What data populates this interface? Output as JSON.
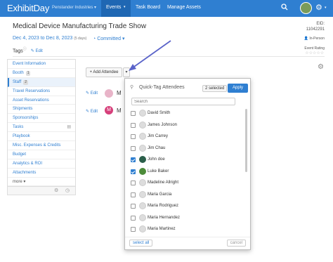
{
  "brand": {
    "logo": "ExhibitDay",
    "org": "Penstander Industries ▾"
  },
  "nav": {
    "events": "Events",
    "task_board": "Task Board",
    "manage_assets": "Manage Assets"
  },
  "event": {
    "title": "Medical Device Manufacturing Trade Show",
    "start": "Dec 4, 2023",
    "to": "to",
    "end": "Dec 8, 2023",
    "days": "(5 days)",
    "status": "Committed ▾",
    "eid_label": "EID:",
    "eid": "11042291",
    "type": "In-Person",
    "rating_label": "Event Rating",
    "tags_label": "Tags",
    "tags_edit": "Edit"
  },
  "sidebar": {
    "items": [
      {
        "label": "Event Information"
      },
      {
        "label": "Booth",
        "badge": "1"
      },
      {
        "label": "Staff",
        "badge": "2"
      },
      {
        "label": "Travel Reservations"
      },
      {
        "label": "Asset Reservations"
      },
      {
        "label": "Shipments"
      },
      {
        "label": "Sponsorships"
      },
      {
        "label": "Tasks"
      },
      {
        "label": "Playbook"
      },
      {
        "label": "Misc. Expenses & Credits"
      },
      {
        "label": "Budget"
      },
      {
        "label": "Analytics & ROI"
      },
      {
        "label": "Attachments"
      },
      {
        "label": "more ▾"
      }
    ]
  },
  "staff": {
    "add_attendee": "+ Add Attendee",
    "rows": [
      {
        "edit": "Edit",
        "initial": "M",
        "name": "M"
      },
      {
        "edit": "Edit",
        "initial": "M",
        "name": "M"
      }
    ]
  },
  "popup": {
    "title": "Quick-Tag Attendees",
    "selected": "2 selected",
    "apply": "Apply",
    "search_placeholder": "Search",
    "options": [
      {
        "name": "David Smith",
        "checked": false
      },
      {
        "name": "James Johnson",
        "checked": false
      },
      {
        "name": "Jim Carrey",
        "checked": false
      },
      {
        "name": "Jim Chau",
        "checked": false
      },
      {
        "name": "John doe",
        "checked": true
      },
      {
        "name": "Luke Baker",
        "checked": true
      },
      {
        "name": "Madeline Allright",
        "checked": false
      },
      {
        "name": "Maria Garcia",
        "checked": false
      },
      {
        "name": "Maria Rodriguez",
        "checked": false
      },
      {
        "name": "Maria Hernandez",
        "checked": false
      },
      {
        "name": "Maria Martinez",
        "checked": false
      }
    ],
    "select_all": "select all",
    "cancel": "cancel"
  },
  "colors": {
    "brand": "#2f7fd1",
    "nav_active": "#1f67b3",
    "arrow": "#5a63c9"
  }
}
